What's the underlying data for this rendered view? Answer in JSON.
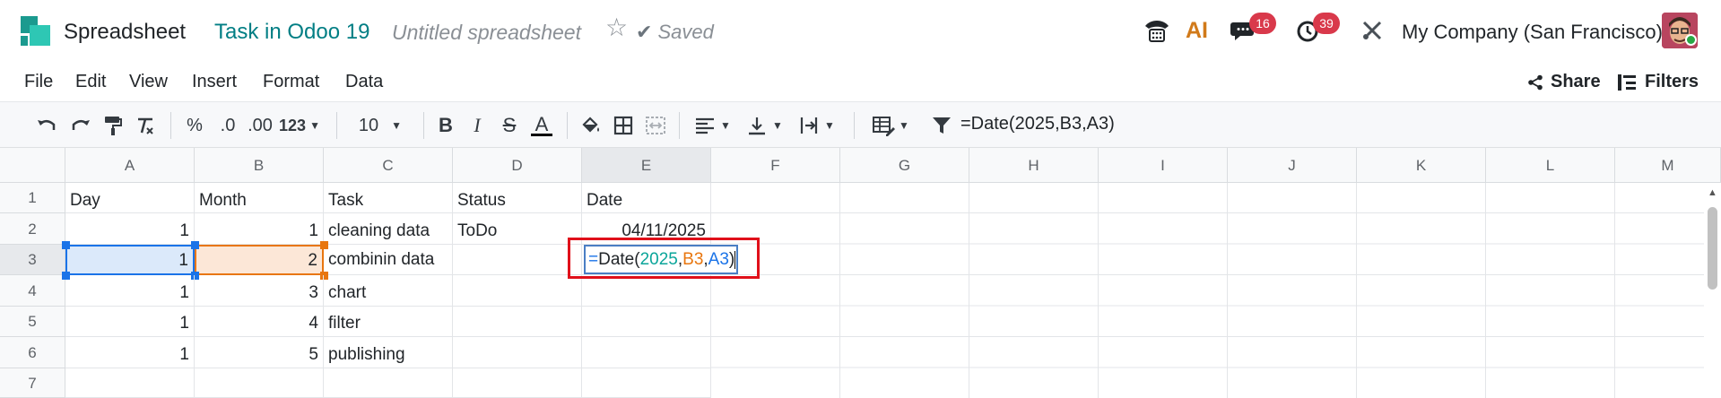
{
  "navbar": {
    "app_name": "Spreadsheet",
    "breadcrumb": "Task in Odoo 19",
    "doc_title": "Untitled spreadsheet",
    "saved_label": "Saved",
    "ai_label": "AI",
    "messages_count": "16",
    "activities_count": "39",
    "company": "My Company (San Francisco)"
  },
  "menu": {
    "items": [
      "File",
      "Edit",
      "View",
      "Insert",
      "Format",
      "Data"
    ],
    "share_label": "Share",
    "filters_label": "Filters"
  },
  "toolbar": {
    "percent": "%",
    "dec_decrease": ".0",
    "dec_increase": ".00",
    "number_format": "123",
    "font_size": "10",
    "bold": "B",
    "italic": "I",
    "strike": "S",
    "text_color": "A",
    "formula": "=Date(2025,B3,A3)"
  },
  "sheet": {
    "columns": [
      "A",
      "B",
      "C",
      "D",
      "E",
      "F",
      "G",
      "H",
      "I",
      "J",
      "K",
      "L",
      "M"
    ],
    "rows": [
      "1",
      "2",
      "3",
      "4",
      "5",
      "6",
      "7"
    ],
    "headers": {
      "a": "Day",
      "b": "Month",
      "c": "Task",
      "d": "Status",
      "e": "Date"
    },
    "data": [
      {
        "a": "1",
        "b": "1",
        "c": "cleaning data",
        "d": "ToDo",
        "e": "04/11/2025"
      },
      {
        "a": "1",
        "b": "2",
        "c": "combinin data",
        "d": "",
        "e": ""
      },
      {
        "a": "1",
        "b": "3",
        "c": "chart",
        "d": "",
        "e": ""
      },
      {
        "a": "1",
        "b": "4",
        "c": "filter",
        "d": "",
        "e": ""
      },
      {
        "a": "1",
        "b": "5",
        "c": "publishing",
        "d": "",
        "e": ""
      }
    ],
    "editor": {
      "eq": "=",
      "fn": "Date(",
      "arg1": "2025",
      "comma1": ",",
      "arg2": "B3",
      "comma2": ",",
      "arg3": "A3",
      "close": ")"
    }
  },
  "colors": {
    "accent_teal": "#017e84",
    "ref_blue": "#1a73e8",
    "ref_orange": "#e8760f",
    "num_green": "#0aa59a",
    "highlight_red": "#e0101a",
    "badge_red": "#d9394b"
  }
}
